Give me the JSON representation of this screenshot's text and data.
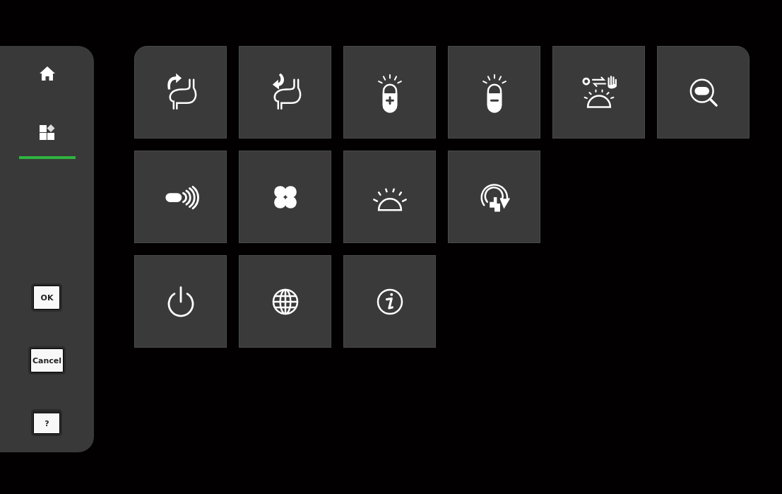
{
  "sidebar": {
    "nav": [
      {
        "kind": "home",
        "selected": false
      },
      {
        "kind": "apps",
        "selected": true
      }
    ],
    "buttons": [
      {
        "label": "OK",
        "kind": "plain"
      },
      {
        "label": "Cancel",
        "kind": "plain"
      },
      {
        "label": "?",
        "kind": "help"
      }
    ]
  },
  "tile_rows": [
    [
      {
        "kind": "stomach-up"
      },
      {
        "kind": "stomach-down"
      },
      {
        "kind": "lamp-plus"
      },
      {
        "kind": "lamp-minus"
      },
      {
        "kind": "auto-manual"
      },
      {
        "kind": "pill-search"
      }
    ],
    [
      {
        "kind": "pill-signal"
      },
      {
        "kind": "fan"
      },
      {
        "kind": "lamp"
      },
      {
        "kind": "refresh"
      }
    ],
    [
      {
        "kind": "power"
      },
      {
        "kind": "globe"
      },
      {
        "kind": "info"
      }
    ]
  ]
}
